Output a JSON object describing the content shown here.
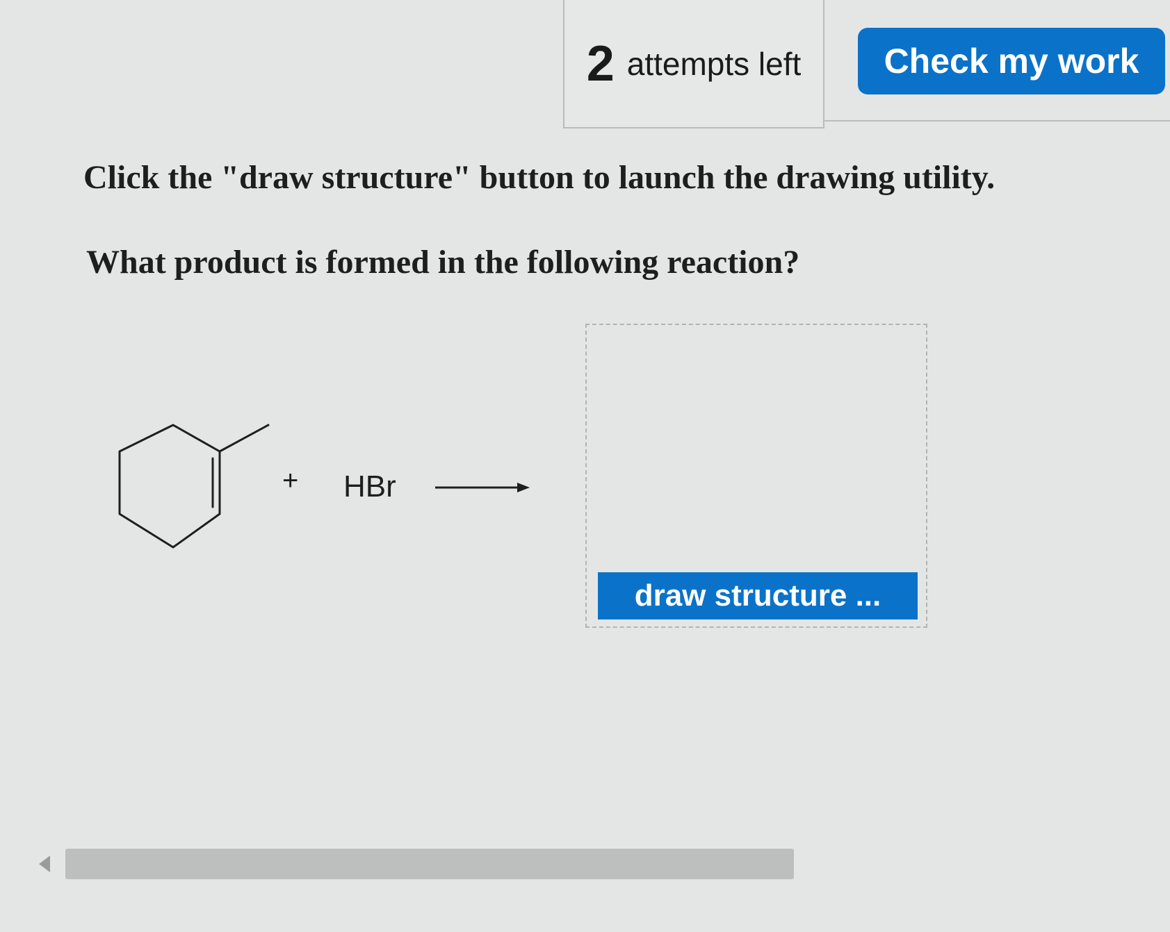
{
  "header": {
    "attempts_count": "2",
    "attempts_label": "attempts left",
    "check_button_label": "Check my work"
  },
  "question": {
    "instruction": "Click the \"draw structure\" button to launch the drawing utility.",
    "prompt": "What product is formed in the following reaction?"
  },
  "reaction": {
    "plus": "+",
    "reagent": "HBr"
  },
  "answer": {
    "draw_button_label": "draw structure ..."
  },
  "colors": {
    "accent": "#0b72c9",
    "background": "#e4e6e5"
  },
  "icons": {
    "scroll_left": "triangle-left-icon",
    "reaction_arrow": "arrow-right-icon"
  }
}
